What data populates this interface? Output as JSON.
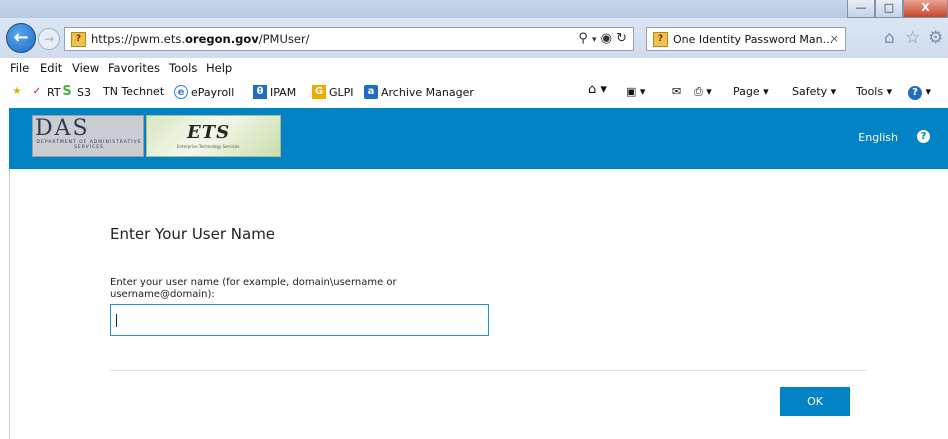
{
  "browser": {
    "url_prefix": "https://pwm.ets.",
    "url_domain": "oregon.gov",
    "url_path": "/PMUser/",
    "tab_title": "One Identity Password Man...",
    "tab_close": "×",
    "window": {
      "minimize": "—",
      "maximize": "□",
      "close": "X"
    },
    "menu": [
      "File",
      "Edit",
      "View",
      "Favorites",
      "Tools",
      "Help"
    ],
    "favorites": [
      {
        "label": "RT",
        "icon": "check-icon",
        "color": "#c8102e"
      },
      {
        "label": "S3",
        "icon": "s3-icon",
        "color": "#4caf50"
      },
      {
        "label": "TN Technet",
        "icon": "tn-icon",
        "color": "#111111"
      },
      {
        "label": "ePayroll",
        "icon": "ie-icon",
        "color": "#3b7dd8"
      },
      {
        "label": "IPAM",
        "icon": "ipam-icon",
        "color": "#1f6cc0"
      },
      {
        "label": "GLPI",
        "icon": "glpi-icon",
        "color": "#f2a900"
      },
      {
        "label": "Archive Manager",
        "icon": "archive-icon",
        "color": "#1f6cc0"
      }
    ],
    "commands": {
      "page": "Page ▾",
      "safety": "Safety ▾",
      "tools": "Tools ▾"
    }
  },
  "header": {
    "logo_das": "DAS",
    "logo_das_sub": "DEPARTMENT OF ADMINISTRATIVE SERVICES",
    "logo_ets": "ETS",
    "logo_ets_tag": "Enterprise Technology Services",
    "language": "English",
    "accent": "#0183c6"
  },
  "form": {
    "title": "Enter Your User Name",
    "label": "Enter your user name (for example, domain\\username or username@domain):",
    "value": "",
    "ok_label": "OK"
  }
}
